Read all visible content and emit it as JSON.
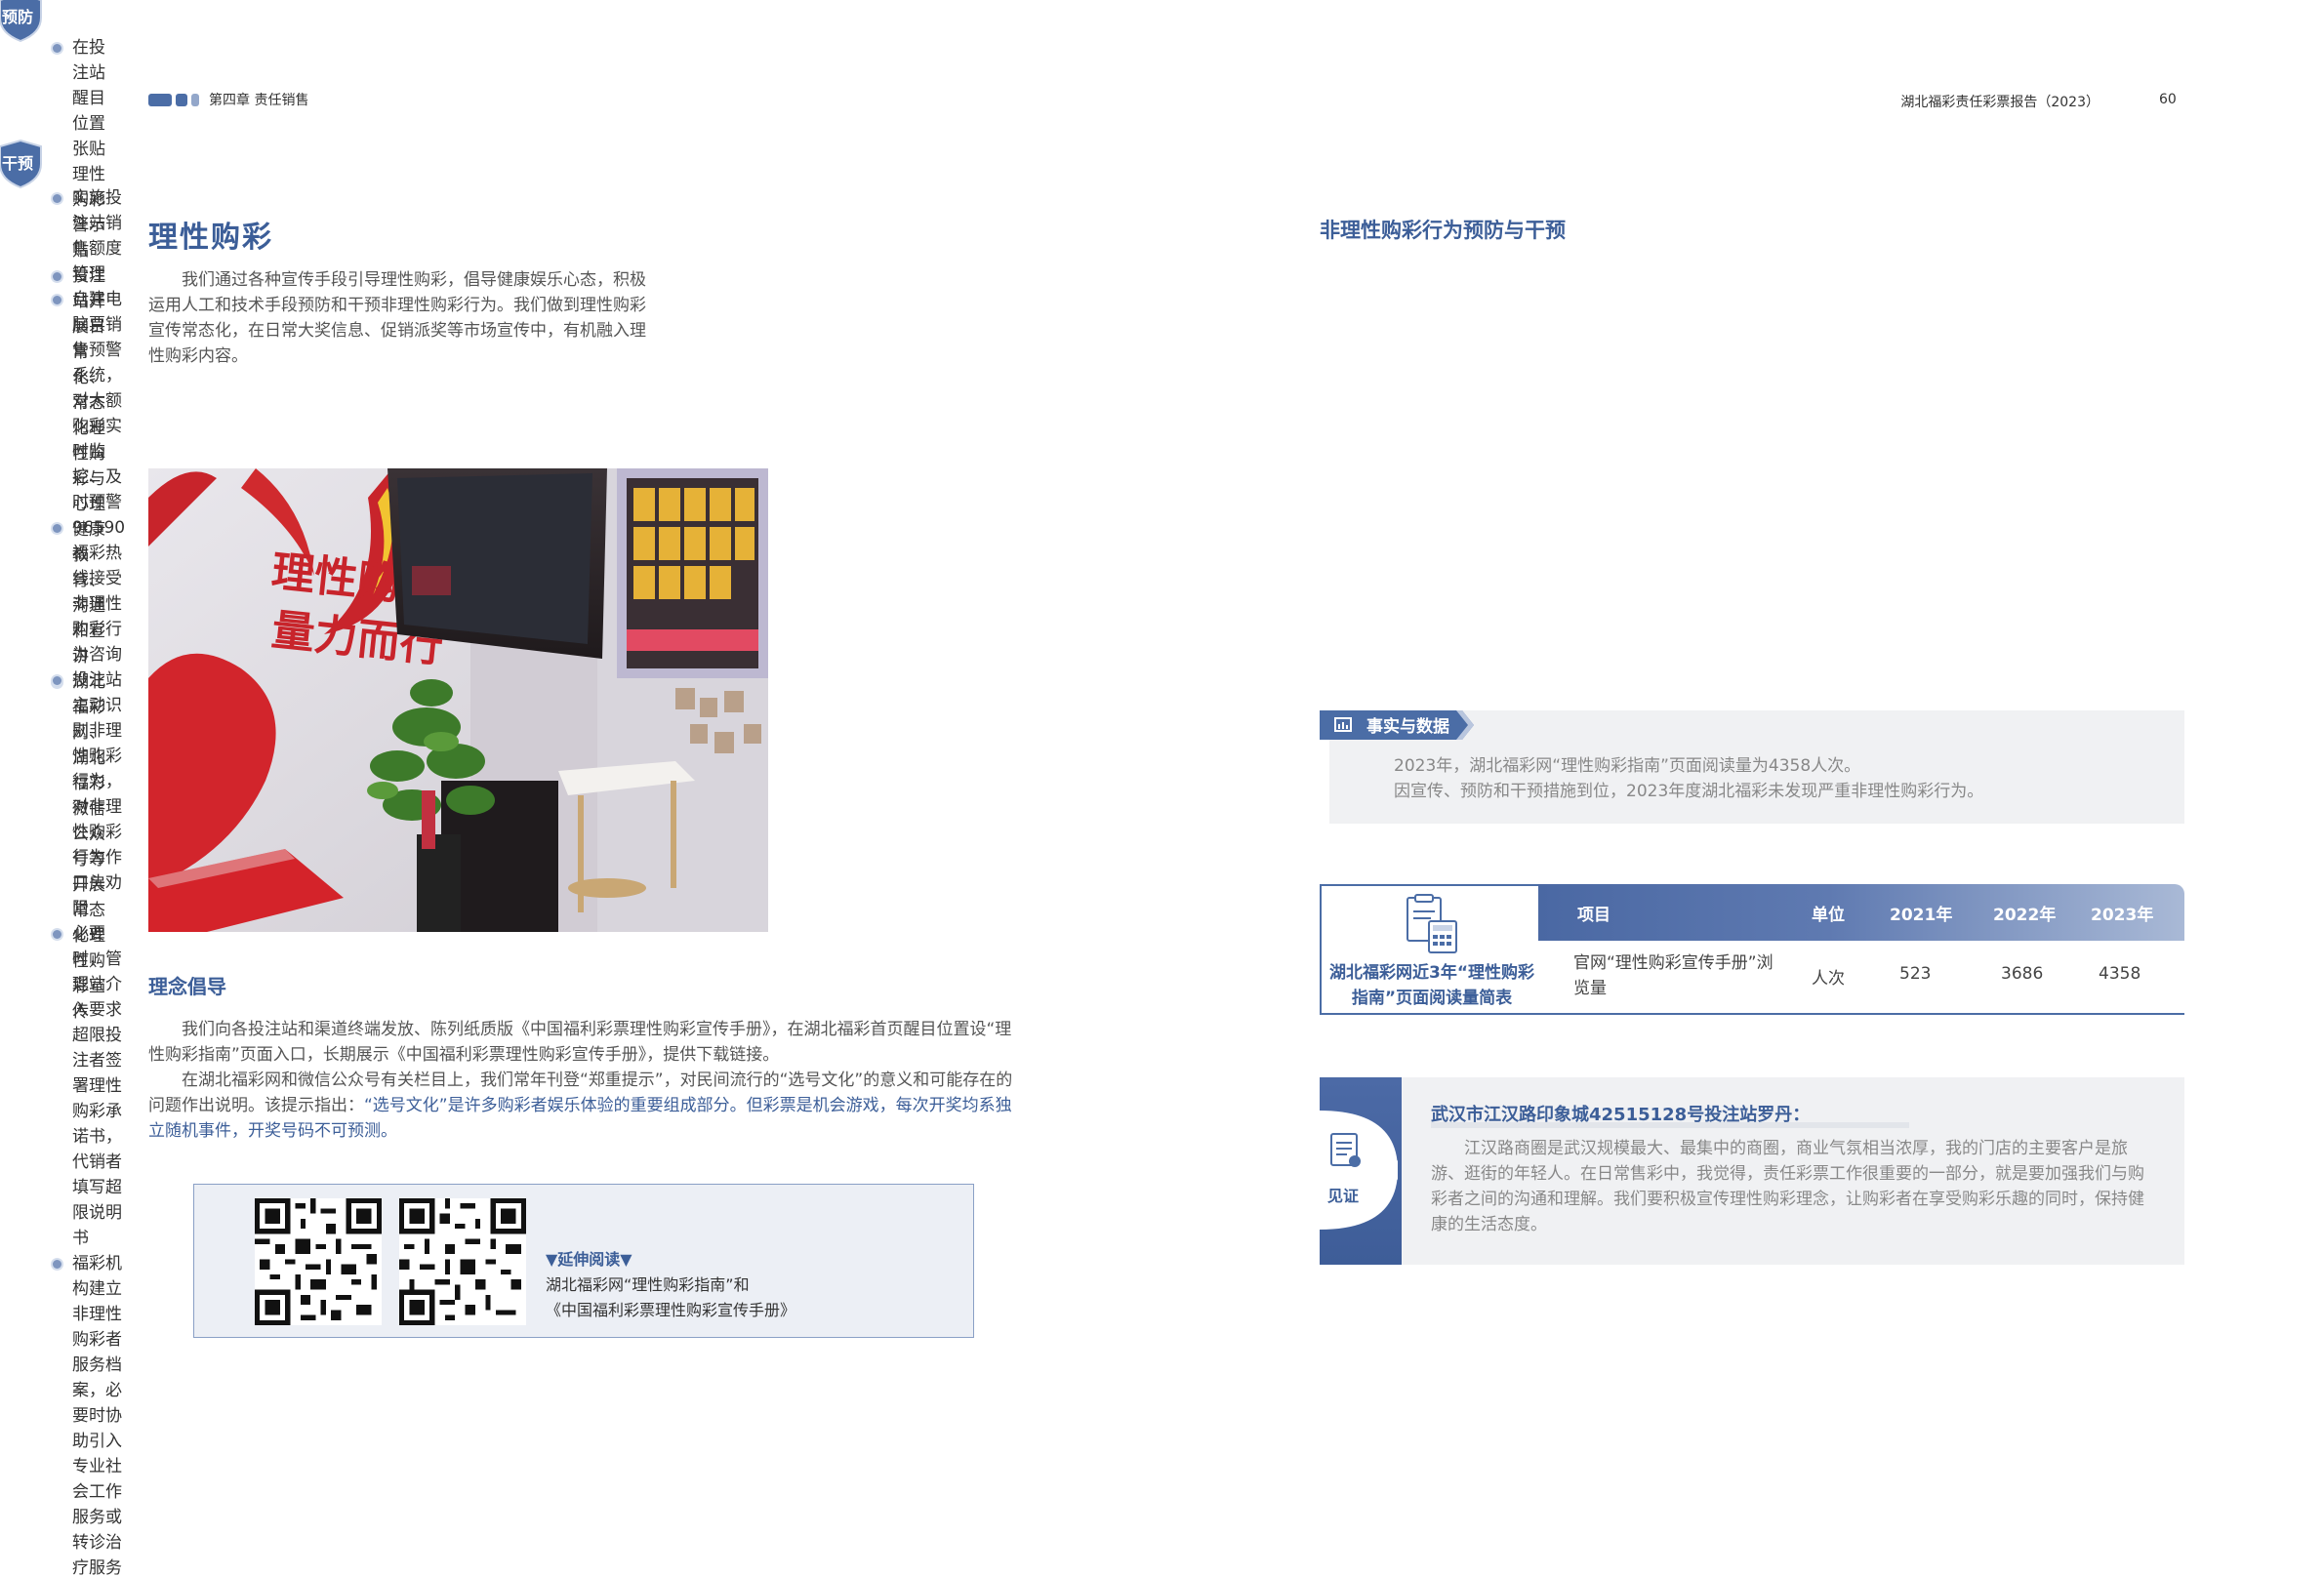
{
  "header": {
    "chapter": "第四章  责任销售",
    "report_title": "湖北福彩责任彩票报告（2023）",
    "page_number": "60"
  },
  "left": {
    "title": "理性购彩",
    "intro": "我们通过各种宣传手段引导理性购彩，倡导健康娱乐心态，积极运用人工和技术手段预防和干预非理性购彩行为。我们做到理性购彩宣传常态化，在日常大奖信息、促销派奖等市场宣传中，有机融入理性购彩内容。",
    "photo": {
      "sign_line1": "理性购彩",
      "sign_line2": "量力而行"
    },
    "section_title": "理念倡导",
    "para1": "我们向各投注站和渠道终端发放、陈列纸质版《中国福利彩票理性购彩宣传手册》，在湖北福彩首页醒目位置设“理性购彩指南”页面入口，长期展示《中国福利彩票理性购彩宣传手册》，提供下载链接。",
    "para2_plain": "在湖北福彩网和微信公众号有关栏目上，我们常年刊登“郑重提示”，对民间流行的“选号文化”的意义和可能存在的问题作出说明。该提示指出：",
    "para2_highlight": "“选号文化”是许多购彩者娱乐体验的重要组成部分。但彩票是机会游戏，每次开奖均系独立随机事件，开奖号码不可预测。",
    "reading": {
      "lead": "▼延伸阅读▼",
      "line1": "湖北福彩网“理性购彩指南”和",
      "line2": "《中国福利彩票理性购彩宣传手册》"
    }
  },
  "right": {
    "title": "非理性购彩行为预防与干预",
    "prevention_label": "预防",
    "prevention_items": [
      "在投注站醒目位置张贴理性购彩警示贴",
      "投注站开展日常化、常态化理性购彩与心理健康教育、沟通和宣讲",
      "湖北福彩网、湖北福彩微信公众号等开展常态化理性购彩宣传"
    ],
    "intervention_label": "干预",
    "intervention_items": [
      "实施投注站销售额度管理",
      "自建电脑票销售预警系统，对大额购彩实时监控、及时预警",
      "96590福彩热线接受非理性购彩行为咨询",
      "投注站主动识别非理性购彩行为，对非理性购彩行为作口头劝阻",
      "必要时，管理站介入要求超限投注者签署理性购彩承诺书，代销者填写超限说明书",
      "福彩机构建立非理性购彩者服务档案，必要时协助引入专业社会工作服务或转诊治疗服务"
    ],
    "facts": {
      "tag": "事实与数据",
      "line1": "2023年，湖北福彩网“理性购彩指南”页面阅读量为4358人次。",
      "line2": "因宣传、预防和干预措施到位，2023年度湖北福彩未发现严重非理性购彩行为。"
    },
    "table": {
      "title": "湖北福彩网近3年“理性购彩指南”页面阅读量简表",
      "headers": [
        "项目",
        "单位",
        "2021年",
        "2022年",
        "2023年"
      ],
      "row": {
        "item": "官网“理性购彩宣传手册”浏览量",
        "unit": "人次",
        "y2021": "523",
        "y2022": "3686",
        "y2023": "4358"
      }
    },
    "witness": {
      "label": "见证",
      "name": "武汉市江汉路印象城42515128号投注站罗丹：",
      "text": "江汉路商圈是武汉规模最大、最集中的商圈，商业气氛相当浓厚，我的门店的主要客户是旅游、逛街的年轻人。在日常售彩中，我觉得，责任彩票工作很重要的一部分，就是要加强我们与购彩者之间的沟通和理解。我们要积极宣传理性购彩理念，让购彩者在享受购彩乐趣的同时，保持健康的生活态度。"
    }
  },
  "colors": {
    "brand_blue": "#3c5e98",
    "light_panel": "#f0f1f3"
  }
}
